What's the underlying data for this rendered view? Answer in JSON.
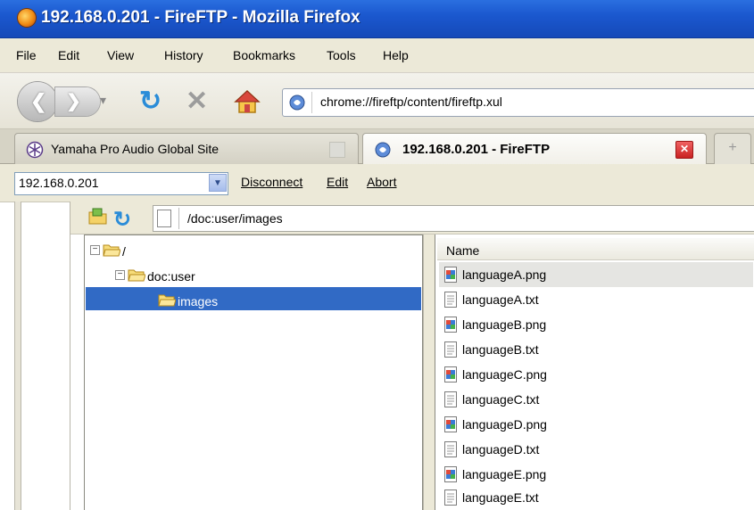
{
  "window": {
    "title": "192.168.0.201 - FireFTP - Mozilla Firefox"
  },
  "menubar": {
    "items": [
      "File",
      "Edit",
      "View",
      "History",
      "Bookmarks",
      "Tools",
      "Help"
    ]
  },
  "navbar": {
    "url": "chrome://fireftp/content/fireftp.xul"
  },
  "tabs": [
    {
      "label": "Yamaha Pro Audio Global Site",
      "active": false
    },
    {
      "label": "192.168.0.201 - FireFTP",
      "active": true
    }
  ],
  "ftp_toolbar": {
    "host": "192.168.0.201",
    "disconnect": "Disconnect",
    "edit": "Edit",
    "abort": "Abort"
  },
  "remote": {
    "path": "/doc:user/images",
    "tree": [
      {
        "label": "/",
        "expanded": true
      },
      {
        "label": "doc:user",
        "expanded": true
      },
      {
        "label": "images",
        "selected": true
      }
    ],
    "column_name": "Name",
    "files": [
      "languageA.png",
      "languageA.txt",
      "languageB.png",
      "languageB.txt",
      "languageC.png",
      "languageC.txt",
      "languageD.png",
      "languageD.txt",
      "languageE.png",
      "languageE.txt"
    ]
  },
  "colors": {
    "titlebar": "#1b58cf",
    "selection": "#316ac5",
    "chrome": "#ece9d8"
  }
}
